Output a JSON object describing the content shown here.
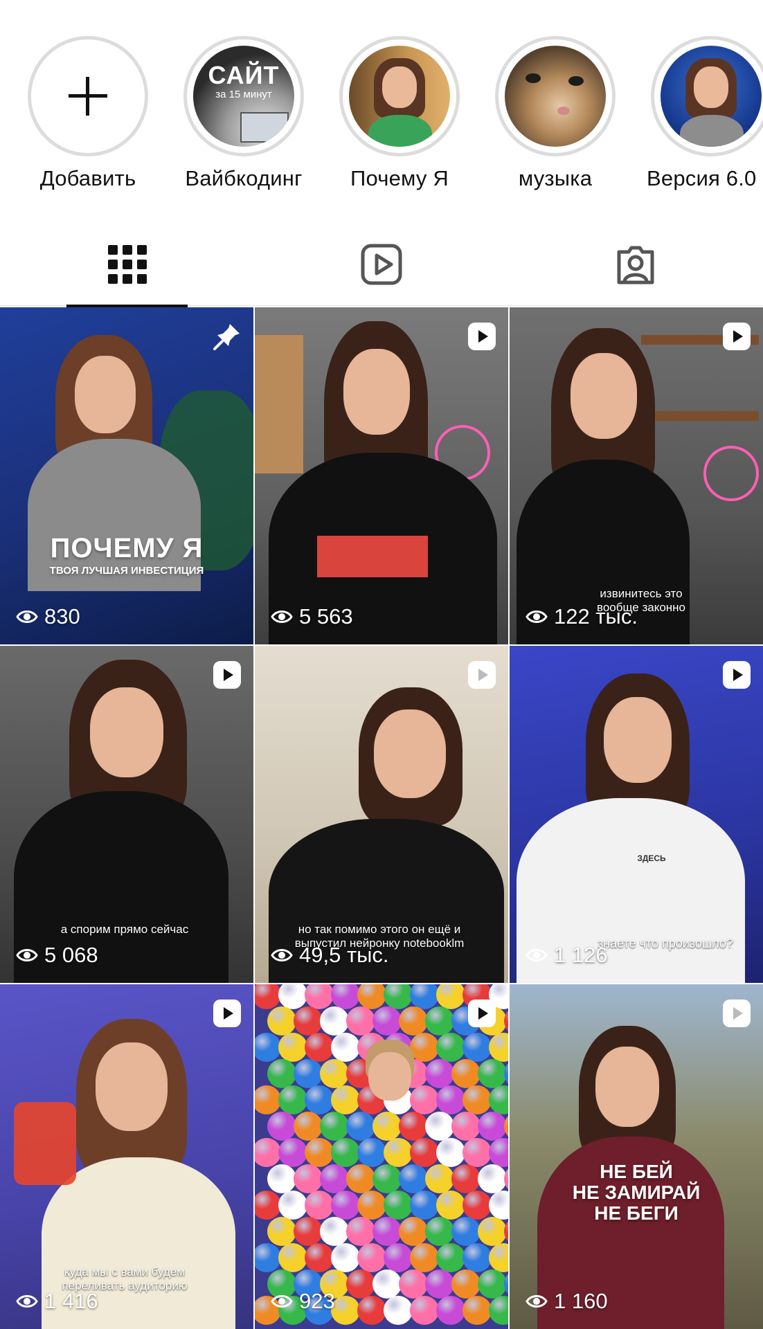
{
  "highlights": [
    {
      "label": "Добавить",
      "icon": "plus-icon"
    },
    {
      "label": "Вайбкодинг",
      "cover_title": "САЙТ",
      "cover_subtitle": "за 15 минут"
    },
    {
      "label": "Почему Я"
    },
    {
      "label": "музыка"
    },
    {
      "label": "Версия 6.0"
    }
  ],
  "tabs": [
    {
      "name": "posts",
      "icon": "grid-icon",
      "active": true
    },
    {
      "name": "reels",
      "icon": "reels-icon",
      "active": false
    },
    {
      "name": "tagged",
      "icon": "tagged-user-icon",
      "active": false
    }
  ],
  "posts": [
    {
      "views": "830",
      "badge": "pin-icon",
      "title": "ПОЧЕМУ Я",
      "subtitle": "ТВОЯ ЛУЧШАЯ ИНВЕСТИЦИЯ"
    },
    {
      "views": "5 563",
      "badge": "reel-icon"
    },
    {
      "views": "122 тыс.",
      "badge": "reel-icon",
      "caption": "извинитесь это вообще законно"
    },
    {
      "views": "5 068",
      "badge": "reel-icon",
      "caption": "а спорим прямо сейчас"
    },
    {
      "views": "49,5 тыс.",
      "badge": "reel-icon",
      "caption": "но так помимо этого он ещё и выпустил нейронку notebooklm"
    },
    {
      "views": "1 126",
      "badge": "reel-icon",
      "caption": "знаете что произошло?",
      "shirt_text": "ЗДЕСЬ"
    },
    {
      "views": "1 416",
      "badge": "reel-icon",
      "caption": "куда мы с вами будем переливать аудиторию"
    },
    {
      "views": "923",
      "badge": "reel-icon"
    },
    {
      "views": "1 160",
      "badge": "reel-icon",
      "title_lines": [
        "НЕ БЕЙ",
        "НЕ ЗАМИРАЙ",
        "НЕ БЕГИ"
      ]
    }
  ],
  "colors": {
    "accent": "#111111",
    "ring": "#dcdcdc",
    "divider": "#e3e3e3"
  }
}
